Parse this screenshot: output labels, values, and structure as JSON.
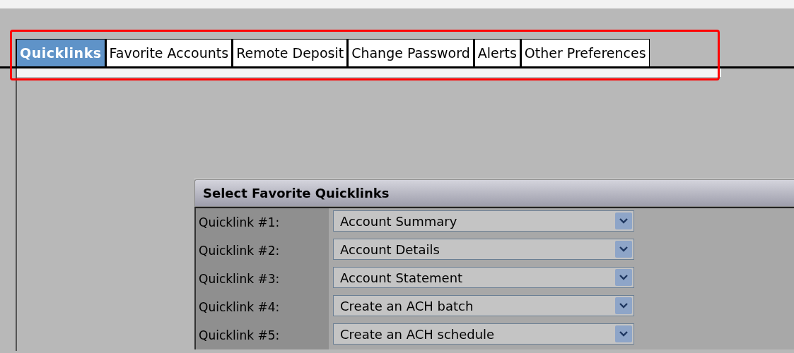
{
  "tabs": [
    {
      "label": "Quicklinks",
      "selected": true
    },
    {
      "label": "Favorite Accounts",
      "selected": false
    },
    {
      "label": "Remote Deposit",
      "selected": false
    },
    {
      "label": "Change Password",
      "selected": false
    },
    {
      "label": "Alerts",
      "selected": false
    },
    {
      "label": "Other Preferences",
      "selected": false
    }
  ],
  "panel": {
    "title": "Select Favorite Quicklinks",
    "rows": [
      {
        "label": "Quicklink #1:",
        "value": "Account Summary"
      },
      {
        "label": "Quicklink #2:",
        "value": "Account Details"
      },
      {
        "label": "Quicklink #3:",
        "value": "Account Statement"
      },
      {
        "label": "Quicklink #4:",
        "value": "Create an ACH batch"
      },
      {
        "label": "Quicklink #5:",
        "value": "Create an ACH schedule"
      }
    ]
  }
}
